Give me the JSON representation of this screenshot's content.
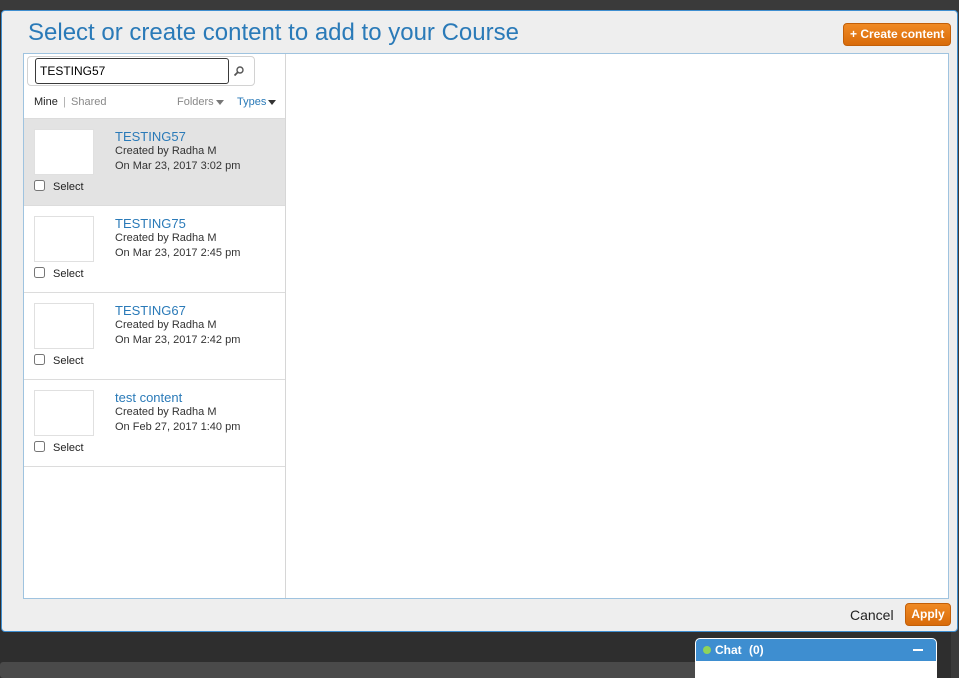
{
  "modal": {
    "title": "Select or create content to add to your Course",
    "create_label": "+ Create content"
  },
  "search": {
    "value": "TESTING57"
  },
  "filters": {
    "mine": "Mine",
    "separator": "|",
    "shared": "Shared",
    "folders": "Folders",
    "types": "Types"
  },
  "items": [
    {
      "title": "TESTING57",
      "created_by": "Created by Radha M",
      "date": "On Mar 23, 2017 3:02 pm",
      "select_label": "Select",
      "selected": true
    },
    {
      "title": "TESTING75",
      "created_by": "Created by Radha M",
      "date": "On Mar 23, 2017 2:45 pm",
      "select_label": "Select",
      "selected": false
    },
    {
      "title": "TESTING67",
      "created_by": "Created by Radha M",
      "date": "On Mar 23, 2017 2:42 pm",
      "select_label": "Select",
      "selected": false
    },
    {
      "title": "test content",
      "created_by": "Created by Radha M",
      "date": "On Feb 27, 2017 1:40 pm",
      "select_label": "Select",
      "selected": false
    }
  ],
  "footer": {
    "cancel_label": "Cancel",
    "apply_label": "Apply"
  },
  "chat": {
    "label": "Chat",
    "count": "(0)"
  },
  "colors": {
    "accent": "#2a7ab8",
    "button_orange": "#e8791a",
    "selected_row": "#e3e3e3",
    "chat_blue": "#3e8ed0",
    "online": "#8ed35a"
  }
}
